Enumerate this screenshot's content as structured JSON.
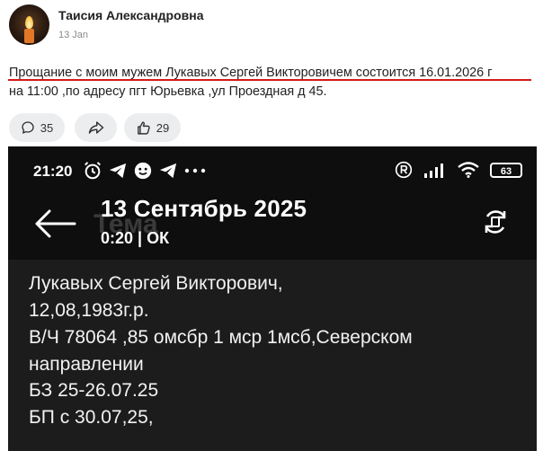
{
  "post": {
    "author": "Таисия Александровна",
    "date": "13 Jan",
    "text_line1": "Прощание с моим мужем Лукавых Сергей Викторовичем состоится 16.01.2026 г",
    "text_line2": "на 11:00 ,по адресу пгт Юрьевка ,ул Проездная д 45.",
    "comments_count": "35",
    "likes_count": "29",
    "underline_color": "#d11a1a"
  },
  "screenshot": {
    "status_time": "21:20",
    "battery": "63",
    "ghost_title": "Тема",
    "call_date": "13 Сентябрь 2025",
    "call_sub": "0:20 | ОК",
    "message_lines": [
      "Лукавых Сергей Викторович,",
      "12,08,1983г.р.",
      "В/Ч 78064 ,85 омсбр 1 мср 1мсб,Северском",
      "направлении",
      "БЗ 25-26.07.25",
      "БП  с 30.07,25,"
    ]
  },
  "icons": [
    "candle-avatar",
    "comment-icon",
    "share-icon",
    "like-icon",
    "back-arrow-icon",
    "rotate-icon",
    "alarm-icon",
    "telegram-icon",
    "signal-icon",
    "wifi-icon",
    "battery-icon"
  ]
}
